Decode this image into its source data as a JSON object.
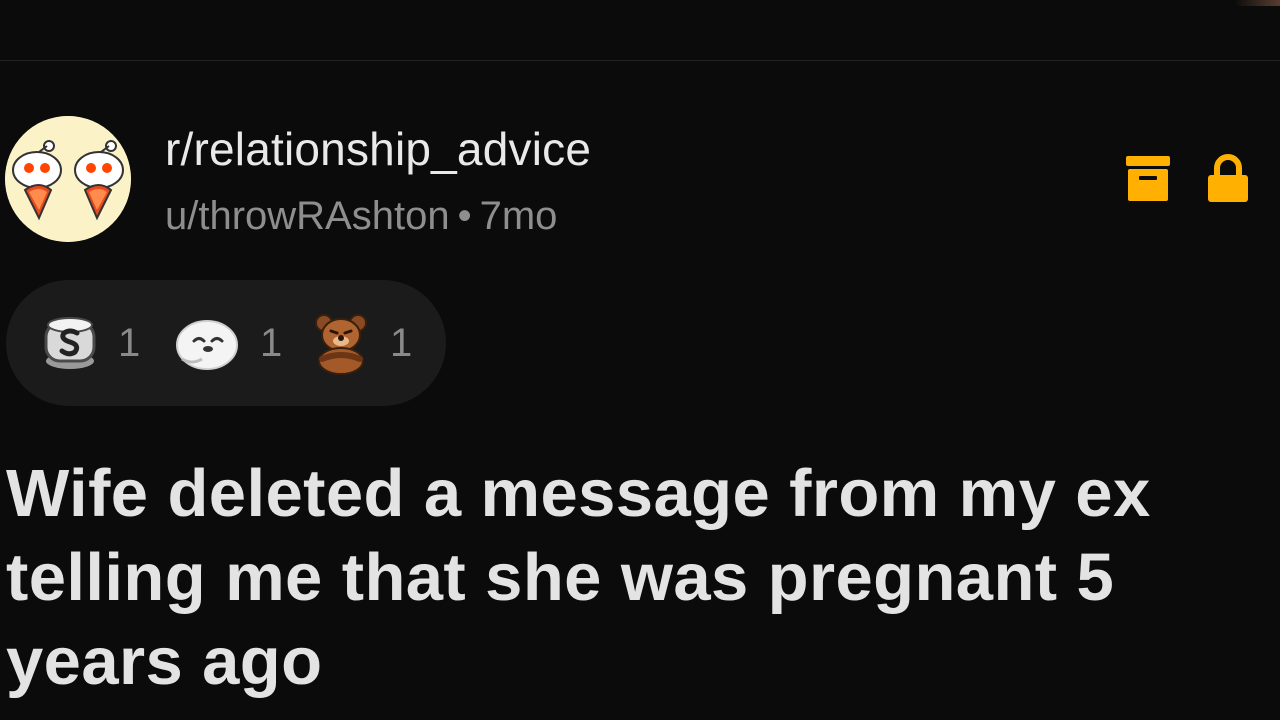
{
  "post": {
    "subreddit": "r/relationship_advice",
    "author": "u/throwRAshton",
    "separator": "•",
    "age": "7mo",
    "title": "Wife deleted a message from my ex telling me that she was pregnant 5 years ago"
  },
  "header_icons": [
    {
      "icon": "archive-icon",
      "color": "#ffb000"
    },
    {
      "icon": "lock-icon",
      "color": "#ffb000"
    }
  ],
  "awards": [
    {
      "icon": "silver-award-icon",
      "count": "1"
    },
    {
      "icon": "seal-award-icon",
      "count": "1"
    },
    {
      "icon": "bear-award-icon",
      "count": "1"
    }
  ],
  "colors": {
    "background": "#0b0b0b",
    "pill": "#1b1b1b",
    "accent": "#ffb000",
    "title_text": "#e3e3e3",
    "meta_text": "#8e8e8e"
  }
}
